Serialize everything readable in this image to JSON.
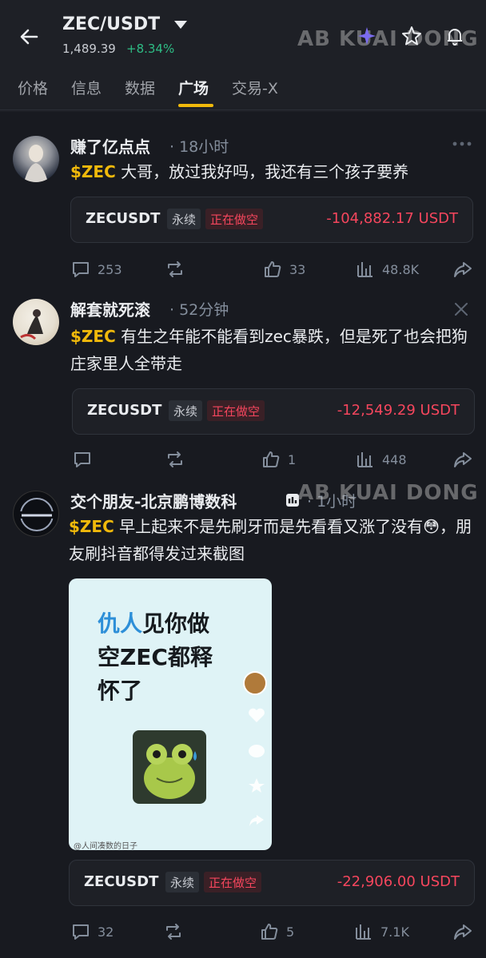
{
  "header": {
    "pair": "ZEC/USDT",
    "price": "1,489.39",
    "change": "+8.34%",
    "watermark": "AB KUAI DONG"
  },
  "tabs": [
    {
      "label": "价格",
      "active": false
    },
    {
      "label": "信息",
      "active": false
    },
    {
      "label": "数据",
      "active": false
    },
    {
      "label": "广场",
      "active": true
    },
    {
      "label": "交易-X",
      "active": false
    }
  ],
  "posts": [
    {
      "author": "赚了亿点点",
      "time": "· 18小时",
      "tag": "$ZEC",
      "text": " 大哥，放过我好吗，我还有三个孩子要养",
      "card": {
        "symbol": "ZECUSDT",
        "type": "永续",
        "position": "正在做空",
        "pnl": "-104,882.17 USDT"
      },
      "stats": {
        "comments": "253",
        "reposts": "",
        "likes": "33",
        "views": "48.8K"
      }
    },
    {
      "author": "解套就死滚",
      "time": "· 52分钟",
      "tag": "$ZEC",
      "text": " 有生之年能不能看到zec暴跌，但是死了也会把狗庄家里人全带走",
      "card": {
        "symbol": "ZECUSDT",
        "type": "永续",
        "position": "正在做空",
        "pnl": "-12,549.29 USDT"
      },
      "stats": {
        "comments": "",
        "reposts": "",
        "likes": "1",
        "views": "448"
      }
    },
    {
      "author": "交个朋友-北京鹏博数科",
      "time": "· 1小时",
      "tag": "$ZEC",
      "text": " 早上起来不是先刷牙而是先看看又涨了没有😳，朋友刷抖音都得发过来截图",
      "image": {
        "line1_blue": "仇人",
        "line1_rest": "见你做",
        "line2": "空ZEC都释",
        "line3": "怀了",
        "caption": "@人间凑数的日子"
      },
      "card": {
        "symbol": "ZECUSDT",
        "type": "永续",
        "position": "正在做空",
        "pnl": "-22,906.00 USDT"
      },
      "stats": {
        "comments": "32",
        "reposts": "",
        "likes": "5",
        "views": "7.1K"
      }
    }
  ],
  "colors": {
    "accent": "#f0b90b",
    "up": "#2ebd85",
    "down": "#f6465d",
    "bg": "#181a20"
  }
}
